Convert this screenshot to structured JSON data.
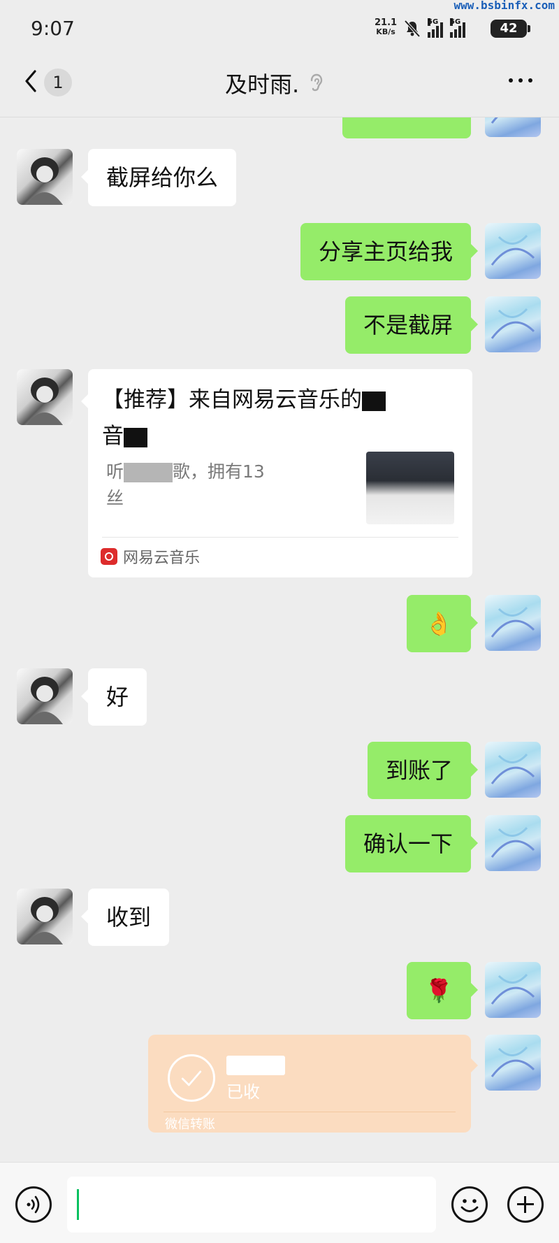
{
  "status_bar": {
    "time": "9:07",
    "watermark": "www.bsbinfx.com",
    "net_speed_value": "21.1",
    "net_speed_unit": "KB/s",
    "network_1": "5G",
    "network_2": "5G",
    "battery": "42"
  },
  "header": {
    "back_icon": "chevron-left-icon",
    "unread_count": "1",
    "title": "及时雨.",
    "ear_icon": "earpiece-icon",
    "more_icon": "more-icon"
  },
  "messages": [
    {
      "from": "me",
      "text": ""
    },
    {
      "from": "them",
      "text": "截屏给你么"
    },
    {
      "from": "me",
      "text": "分享主页给我"
    },
    {
      "from": "me",
      "text": "不是截屏"
    },
    {
      "from": "them",
      "type": "share-card",
      "title_part1": "【推荐】来自网易云音乐的",
      "title_part2": "音",
      "desc_line1_a": "听",
      "desc_line1_b": "歌，拥有13",
      "desc_line2": "丝",
      "source": "网易云音乐"
    },
    {
      "from": "me",
      "text": "👌"
    },
    {
      "from": "them",
      "text": "好"
    },
    {
      "from": "me",
      "text": "到账了"
    },
    {
      "from": "me",
      "text": "确认一下"
    },
    {
      "from": "them",
      "text": "收到"
    },
    {
      "from": "me",
      "text": "🌹"
    },
    {
      "from": "me",
      "type": "transfer",
      "status": "已收",
      "label": "微信转账"
    }
  ],
  "toolbar": {
    "voice_icon": "voice-icon",
    "input_value": "",
    "emoji_icon": "emoji-icon",
    "plus_icon": "plus-icon"
  },
  "colors": {
    "background": "#ededed",
    "outgoing_bubble": "#95ec69",
    "incoming_bubble": "#ffffff",
    "transfer_bubble": "#fbdcc0",
    "netease_red": "#dd2c2c"
  }
}
